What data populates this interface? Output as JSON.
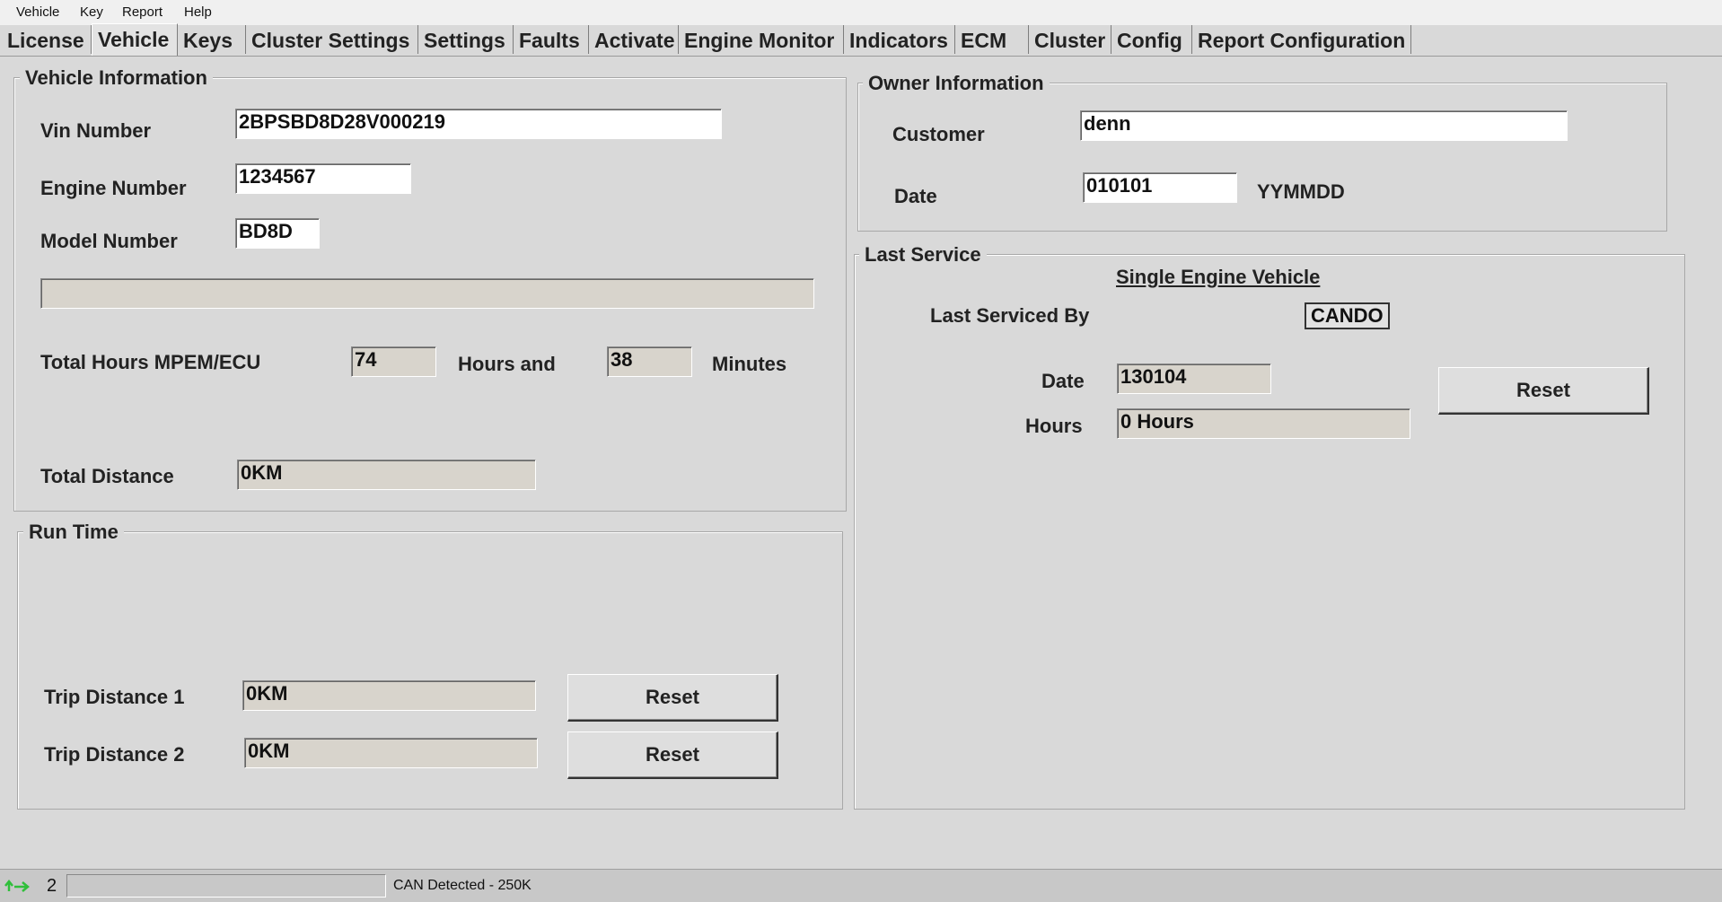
{
  "menu": {
    "items": [
      "Vehicle",
      "Key",
      "Report",
      "Help"
    ]
  },
  "tabs": [
    "License",
    "Vehicle",
    "Keys",
    "Cluster Settings",
    "Settings",
    "Faults",
    "Activate",
    "Engine Monitor",
    "Indicators",
    "ECM",
    "Cluster",
    "Config",
    "Report Configuration"
  ],
  "active_tab": "Vehicle",
  "vehicle_info": {
    "title": "Vehicle Information",
    "vin_label": "Vin Number",
    "vin_value": "2BPSBD8D28V000219",
    "engine_label": "Engine Number",
    "engine_value": "1234567",
    "model_label": "Model Number",
    "model_value": "BD8D",
    "extra_value": "",
    "hours_label": "Total Hours MPEM/ECU",
    "hours_value": "74",
    "hours_and": "Hours and",
    "minutes_value": "38",
    "minutes_label": "Minutes",
    "distance_label": "Total Distance",
    "distance_value": "0KM"
  },
  "run_time": {
    "title": "Run Time",
    "trip1_label": "Trip Distance 1",
    "trip1_value": "0KM",
    "trip2_label": "Trip Distance 2",
    "trip2_value": "0KM",
    "reset_label": "Reset"
  },
  "owner_info": {
    "title": "Owner Information",
    "customer_label": "Customer",
    "customer_value": "denn",
    "date_label": "Date",
    "date_value": "010101",
    "date_format": "YYMMDD"
  },
  "last_service": {
    "title": "Last Service",
    "vehicle_type": "Single Engine Vehicle",
    "serviced_by_label": "Last Serviced By",
    "serviced_by_value": "CANDO",
    "date_label": "Date",
    "date_value": "130104",
    "hours_label": "Hours",
    "hours_value": "0 Hours",
    "reset_label": "Reset"
  },
  "status": {
    "indicator": "2",
    "progress_text": "",
    "message": "CAN Detected - 250K"
  }
}
